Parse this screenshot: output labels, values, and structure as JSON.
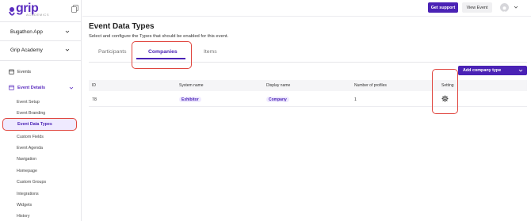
{
  "app": {
    "logo_text": "grip",
    "logo_sub": "ACADEMICS"
  },
  "sidebar": {
    "app_selector": "Bugathon App",
    "academy_selector": "Grip Academy",
    "events_label": "Events",
    "section_label": "Event Details",
    "sub_items": [
      {
        "label": "Event Setup"
      },
      {
        "label": "Event Branding"
      },
      {
        "label": "Event Data Types"
      },
      {
        "label": "Custom Fields"
      },
      {
        "label": "Event Agenda"
      },
      {
        "label": "Navigation"
      },
      {
        "label": "Homepage"
      },
      {
        "label": "Custom Groups"
      },
      {
        "label": "Integrations"
      },
      {
        "label": "Widgets"
      },
      {
        "label": "History"
      }
    ],
    "active_item": "Event Data Types"
  },
  "header": {
    "support_label": "Get support",
    "view_event_label": "View Event"
  },
  "main": {
    "title": "Event Data Types",
    "subtitle": "Select and configure the Types that should be enabled for this event.",
    "tabs": [
      {
        "label": "Participants"
      },
      {
        "label": "Companies"
      },
      {
        "label": "Items"
      }
    ],
    "active_tab": "Companies",
    "add_button_label": "Add company type",
    "table": {
      "headers": [
        "ID",
        "System name",
        "Display name",
        "Number of profiles",
        "Setting"
      ],
      "rows": [
        {
          "id": "78",
          "system_name": "Exhibitor",
          "display_name": "Company",
          "profiles": "1"
        }
      ]
    }
  },
  "colors": {
    "brand": "#4a22b5",
    "highlight": "#e0463f"
  }
}
